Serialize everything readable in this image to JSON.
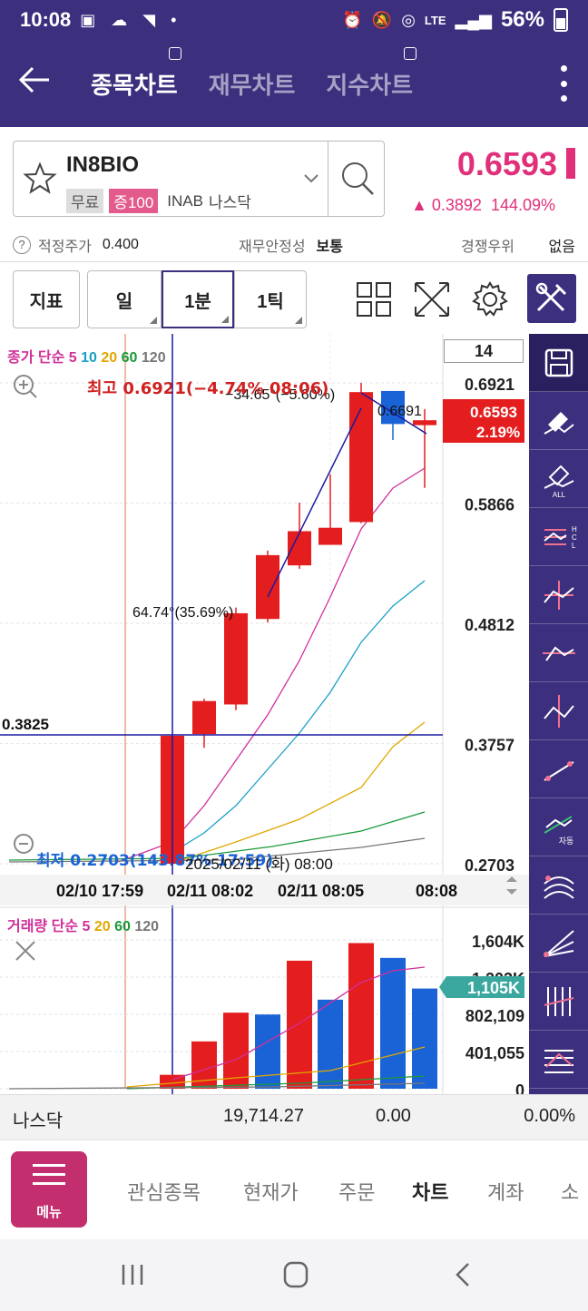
{
  "status": {
    "time": "10:08",
    "battery": "56%",
    "network": "LTE"
  },
  "header": {
    "tabs": [
      {
        "label": "종목차트",
        "active": true
      },
      {
        "label": "재무차트",
        "active": false
      },
      {
        "label": "지수차트",
        "active": false
      }
    ]
  },
  "stock": {
    "name": "IN8BIO",
    "tag_free": "무료",
    "tag_margin": "증100",
    "code": "INAB",
    "market": "나스닥",
    "price": "0.6593",
    "change_value": "▲ 0.3892",
    "change_pct": "144.09%"
  },
  "fair": {
    "label": "적정주가",
    "value": "0.400",
    "fin_label": "재무안정성",
    "fin_value": "보통",
    "comp_label": "경쟁우위",
    "comp_value": "없음"
  },
  "toolbar": {
    "indicator": "지표",
    "day": "일",
    "minute": "1분",
    "tick": "1틱"
  },
  "chart_data": {
    "type": "candlestick",
    "period_count": "14",
    "legend": {
      "title": "종가 단순",
      "periods": [
        "5",
        "10",
        "20",
        "60",
        "120"
      ],
      "colors": [
        "#d0309a",
        "#1aa0c8",
        "#e0a800",
        "#1a9a3a",
        "#777777"
      ]
    },
    "y_axis_labels": [
      "0.6921",
      "0.5866",
      "0.4812",
      "0.3757",
      "0.2703"
    ],
    "ylim": [
      0.2703,
      0.6921
    ],
    "x_axis_labels": [
      "02/10 17:59",
      "02/11 08:02",
      "02/11 08:05",
      "08:08"
    ],
    "cursor_value": "0.3825",
    "cursor_date": "2025/02/11 (화) 08:00",
    "high_label": "최고 0.6921(−4.74% 08:06)",
    "low_label": "최저 0.2703(143.87% 17:59)",
    "price_tag": "0.6593",
    "price_tag_pct": "2.19%",
    "annotations": [
      {
        "text": "64.74°(35.69%)"
      },
      {
        "text": "−34.65°(−5.60%)"
      },
      {
        "text": "0.6691"
      }
    ],
    "candles": [
      {
        "o": 0.2703,
        "h": 0.3825,
        "l": 0.2703,
        "c": 0.3825,
        "up": true
      },
      {
        "o": 0.384,
        "h": 0.415,
        "l": 0.372,
        "c": 0.413,
        "up": true
      },
      {
        "o": 0.41,
        "h": 0.495,
        "l": 0.405,
        "c": 0.49,
        "up": true
      },
      {
        "o": 0.485,
        "h": 0.545,
        "l": 0.482,
        "c": 0.541,
        "up": true
      },
      {
        "o": 0.532,
        "h": 0.587,
        "l": 0.529,
        "c": 0.562,
        "up": true
      },
      {
        "o": 0.55,
        "h": 0.612,
        "l": 0.55,
        "c": 0.565,
        "up": true
      },
      {
        "o": 0.57,
        "h": 0.6921,
        "l": 0.569,
        "c": 0.684,
        "up": true
      },
      {
        "o": 0.685,
        "h": 0.685,
        "l": 0.642,
        "c": 0.656,
        "up": false
      },
      {
        "o": 0.655,
        "h": 0.6691,
        "l": 0.6,
        "c": 0.6593,
        "up": true
      }
    ],
    "volume": {
      "legend_title": "거래량 단순",
      "periods": [
        "5",
        "20",
        "60",
        "120"
      ],
      "colors": [
        "#d0309a",
        "#e0a800",
        "#1a9a3a",
        "#777777"
      ],
      "y_axis_labels": [
        "1,604K",
        "1,203K",
        "802,109",
        "401,055",
        "0"
      ],
      "current_tag": "1,105K",
      "ylim": [
        0,
        1604000
      ],
      "bars": [
        {
          "v": 150000,
          "up": true
        },
        {
          "v": 510000,
          "up": true
        },
        {
          "v": 820000,
          "up": true
        },
        {
          "v": 800000,
          "up": false
        },
        {
          "v": 1380000,
          "up": true
        },
        {
          "v": 960000,
          "up": false
        },
        {
          "v": 1570000,
          "up": true
        },
        {
          "v": 1410000,
          "up": false
        },
        {
          "v": 1080000,
          "up": false
        }
      ]
    }
  },
  "index": {
    "name": "나스닥",
    "value": "19,714.27",
    "change": "0.00",
    "pct": "0.00%"
  },
  "bottom_nav": {
    "menu": "메뉴",
    "items": [
      {
        "label": "관심종목",
        "active": false
      },
      {
        "label": "현재가",
        "active": false
      },
      {
        "label": "주문",
        "active": false
      },
      {
        "label": "차트",
        "active": true
      },
      {
        "label": "계좌",
        "active": false
      },
      {
        "label": "소",
        "active": false
      }
    ]
  },
  "colors": {
    "brand": "#3b2f7e",
    "up": "#e41e1e",
    "down": "#1a63d6",
    "accent": "#e0307a",
    "menu": "#c22e6e"
  }
}
